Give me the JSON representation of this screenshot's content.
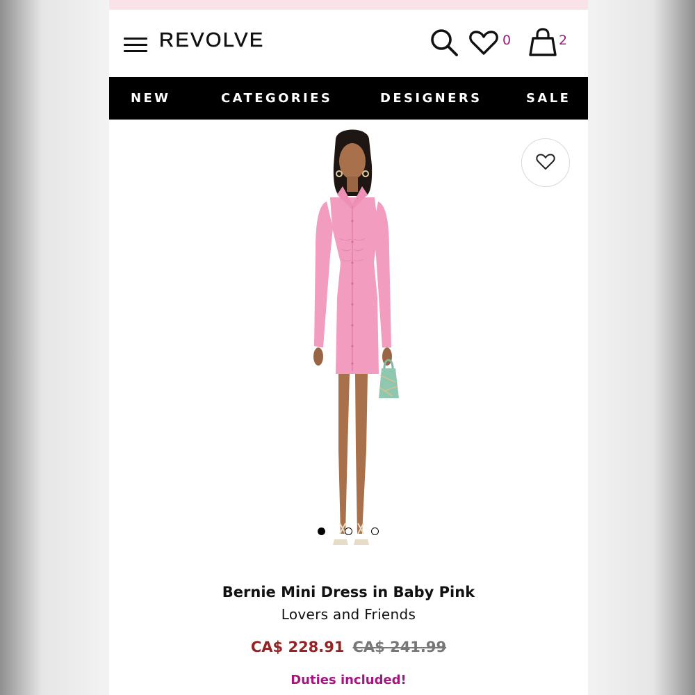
{
  "header": {
    "logo": "REVOLVE",
    "wishlist_count": "0",
    "cart_count": "2",
    "icons": [
      "menu-icon",
      "search-icon",
      "heart-icon",
      "bag-icon"
    ]
  },
  "nav": {
    "items": [
      {
        "label": "NEW"
      },
      {
        "label": "CATEGORIES"
      },
      {
        "label": "DESIGNERS"
      },
      {
        "label": "SALE"
      }
    ]
  },
  "product": {
    "title": "Bernie Mini Dress in Baby Pink",
    "brand": "Lovers and Friends",
    "sale_price": "CA$ 228.91",
    "original_price": "CA$ 241.99",
    "duties_note": "Duties included!",
    "image_count": 3,
    "active_image": 1
  },
  "colors": {
    "accent_magenta": "#a4167f",
    "sale_red": "#952323",
    "dress_pink": "#f29cc0",
    "nav_bg": "#000000"
  }
}
